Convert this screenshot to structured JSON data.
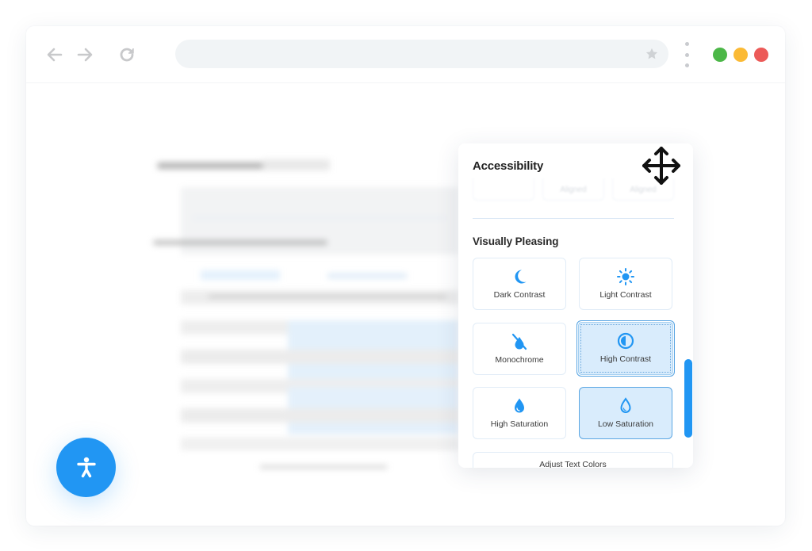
{
  "browser": {
    "nav": {
      "back_icon": "arrow-left-icon",
      "forward_icon": "arrow-right-icon",
      "reload_icon": "reload-icon"
    },
    "addressbar": {
      "value": "",
      "bookmark_icon": "star-icon"
    },
    "menu_icon": "kebab-menu-icon",
    "window_controls": [
      {
        "name": "green",
        "color": "#4cb748"
      },
      {
        "name": "yellow",
        "color": "#fbba35"
      },
      {
        "name": "red",
        "color": "#ec5a58"
      }
    ]
  },
  "panel": {
    "title": "Accessibility",
    "move_icon": "move-arrows-icon",
    "faded_options": [
      "",
      "Aligned",
      "Aligned"
    ],
    "section_title": "Visually Pleasing",
    "tiles": [
      {
        "label": "Dark Contrast",
        "icon": "moon-icon",
        "active": false
      },
      {
        "label": "Light Contrast",
        "icon": "sun-icon",
        "active": false
      },
      {
        "label": "Monochrome",
        "icon": "no-color-drop-icon",
        "active": false
      },
      {
        "label": "High Contrast",
        "icon": "contrast-icon",
        "active": true
      },
      {
        "label": "High Saturation",
        "icon": "drop-filled-icon",
        "active": false
      },
      {
        "label": "Low Saturation",
        "icon": "drop-outline-icon",
        "active": true
      }
    ],
    "wide_tile": {
      "label": "Adjust Text Colors"
    }
  },
  "accessibility_button": {
    "icon": "accessibility-person-icon"
  },
  "colors": {
    "accent": "#2196f3",
    "active_tile_bg": "#d9ecfc",
    "active_tile_border": "#5aa6e3"
  }
}
